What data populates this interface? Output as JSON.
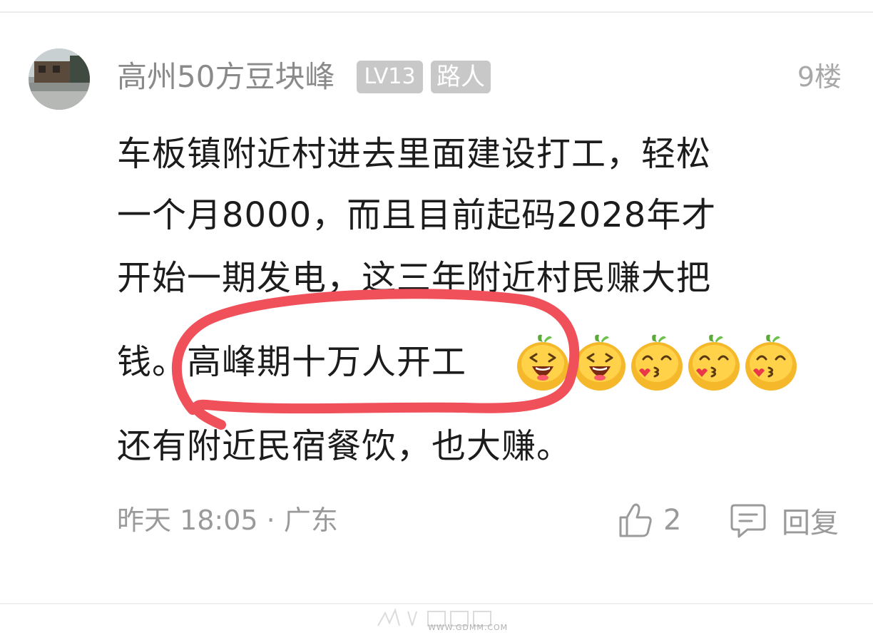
{
  "comment": {
    "username": "高州50方豆块峰",
    "level_badge": "LV13",
    "role_badge": "路人",
    "floor": "9楼",
    "content_lines": [
      "车板镇附近村进去里面建设打工，轻松",
      "一个月8000，而且目前起码2028年才",
      "开始一期发电，这三年附近村民赚大把",
      "钱。高峰期十万人开工",
      "还有附近民宿餐饮，也大赚。"
    ],
    "emojis": [
      "laughing-orange-emoji",
      "laughing-orange-emoji",
      "kiss-orange-emoji",
      "kiss-orange-emoji",
      "kiss-orange-emoji"
    ],
    "time_location": "昨天 18:05 · 广东",
    "like_count": "2",
    "reply_label": "回复",
    "annotation_color": "#f0505a"
  },
  "watermark": {
    "text": "WWW.GDMM.COM"
  }
}
